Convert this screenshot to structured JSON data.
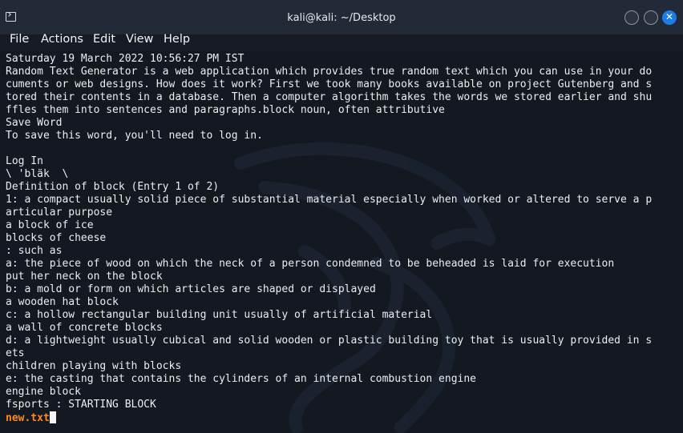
{
  "window": {
    "title": "kali@kali: ~/Desktop",
    "icon": "terminal-icon",
    "controls": [
      "minimize-icon",
      "maximize-icon",
      "close-icon"
    ],
    "close_glyph": "✕",
    "accent_color": "#1c7ce8"
  },
  "menu": {
    "items": [
      {
        "label": "File"
      },
      {
        "label": "Actions"
      },
      {
        "label": "Edit"
      },
      {
        "label": "View"
      },
      {
        "label": "Help"
      }
    ]
  },
  "terminal": {
    "background_color": "#131821",
    "text_color": "#eceef1",
    "lines": [
      "Saturday 19 March 2022 10:56:27 PM IST",
      "Random Text Generator is a web application which provides true random text which you can use in your do",
      "cuments or web designs. How does it work? First we took many books available on project Gutenberg and s",
      "tored their contents in a database. Then a computer algorithm takes the words we stored earlier and shu",
      "ffles them into sentences and paragraphs.block noun, often attributive",
      "Save Word",
      "To save this word, you'll need to log in.",
      "",
      "Log In",
      "\\ 'bläk  \\",
      "Definition of block (Entry 1 of 2)",
      "1: a compact usually solid piece of substantial material especially when worked or altered to serve a p",
      "articular purpose",
      "a block of ice",
      "blocks of cheese",
      ": such as",
      "a: the piece of wood on which the neck of a person condemned to be beheaded is laid for execution",
      "put her neck on the block",
      "b: a mold or form on which articles are shaped or displayed",
      "a wooden hat block",
      "c: a hollow rectangular building unit usually of artificial material",
      "a wall of concrete blocks",
      "d: a lightweight usually cubical and solid wooden or plastic building toy that is usually provided in s",
      "ets",
      "children playing with blocks",
      "e: the casting that contains the cylinders of an internal combustion engine",
      "engine block",
      "fsports : STARTING BLOCK"
    ],
    "prompt": {
      "filename": "new.txt",
      "filename_color": "#ff8a1f"
    }
  }
}
